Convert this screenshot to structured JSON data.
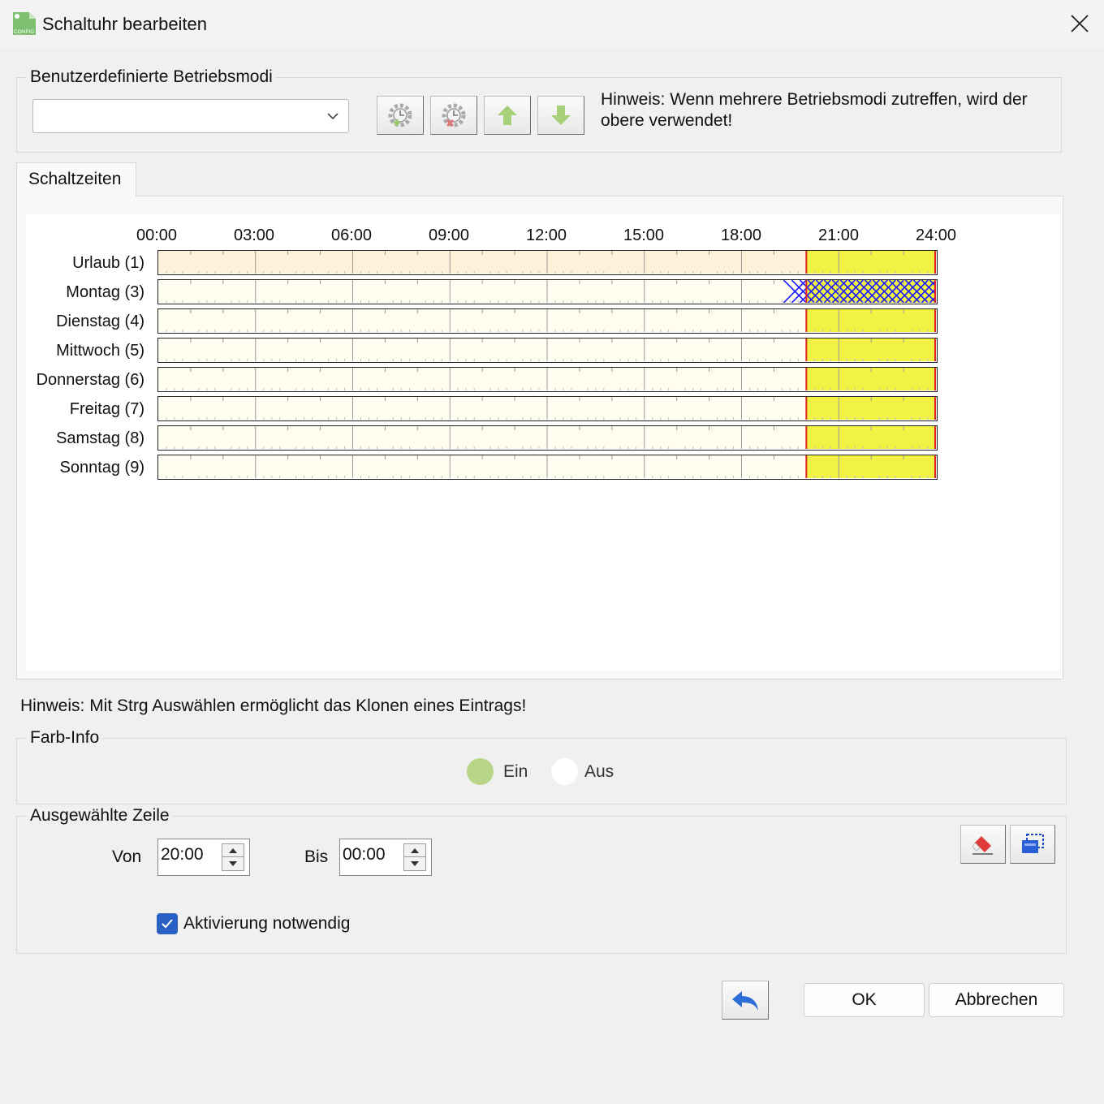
{
  "window": {
    "title": "Schaltuhr bearbeiten",
    "app_icon_text": "CONFIG"
  },
  "modes_group": {
    "legend": "Benutzerdefinierte Betriebsmodi",
    "combo_value": "",
    "buttons": [
      "add-mode-icon",
      "delete-mode-icon",
      "move-up-icon",
      "move-down-icon"
    ],
    "hint": "Hinweis: Wenn mehrere Betriebsmodi zutreffen, wird der obere verwendet!"
  },
  "tabs": [
    {
      "label": "Schaltzeiten",
      "selected": true
    }
  ],
  "schedule": {
    "hour_labels": [
      "00:00",
      "03:00",
      "06:00",
      "09:00",
      "12:00",
      "15:00",
      "18:00",
      "21:00",
      "24:00"
    ],
    "rows": [
      {
        "label": "Urlaub (1)",
        "on_from": 20,
        "on_to": 24,
        "pattern": "solid",
        "background": "#fdf2d9"
      },
      {
        "label": "Montag (3)",
        "on_from": 20,
        "on_to": 24,
        "pattern": "crosshatch",
        "background": "#fffdf0"
      },
      {
        "label": "Dienstag (4)",
        "on_from": 20,
        "on_to": 24,
        "pattern": "solid",
        "background": "#fffdf0"
      },
      {
        "label": "Mittwoch (5)",
        "on_from": 20,
        "on_to": 24,
        "pattern": "solid",
        "background": "#fffdf0"
      },
      {
        "label": "Donnerstag (6)",
        "on_from": 20,
        "on_to": 24,
        "pattern": "solid",
        "background": "#fffdf0"
      },
      {
        "label": "Freitag (7)",
        "on_from": 20,
        "on_to": 24,
        "pattern": "solid",
        "background": "#fffdf0"
      },
      {
        "label": "Samstag (8)",
        "on_from": 20,
        "on_to": 24,
        "pattern": "solid",
        "background": "#fffdf0"
      },
      {
        "label": "Sonntag (9)",
        "on_from": 20,
        "on_to": 24,
        "pattern": "solid",
        "background": "#fffdf0"
      }
    ],
    "on_color": "#f2f244",
    "hatch_color": "#1a1aff",
    "marker_color": "#e02020"
  },
  "hint_clone": "Hinweis: Mit Strg Auswählen ermöglicht das Klonen eines Eintrags!",
  "color_info": {
    "legend": "Farb-Info",
    "items": [
      {
        "label": "Ein",
        "color": "#b9d588"
      },
      {
        "label": "Aus",
        "color": "#ffffff"
      }
    ]
  },
  "selected_row": {
    "legend": "Ausgewählte Zeile",
    "from_label": "Von",
    "from_value": "20:00",
    "to_label": "Bis",
    "to_value": "00:00",
    "activation_label": "Aktivierung notwendig",
    "activation_checked": true,
    "action_icons": [
      "eraser-icon",
      "clone-icon"
    ]
  },
  "footer": {
    "undo_icon": "undo-icon",
    "ok_label": "OK",
    "cancel_label": "Abbrechen"
  }
}
